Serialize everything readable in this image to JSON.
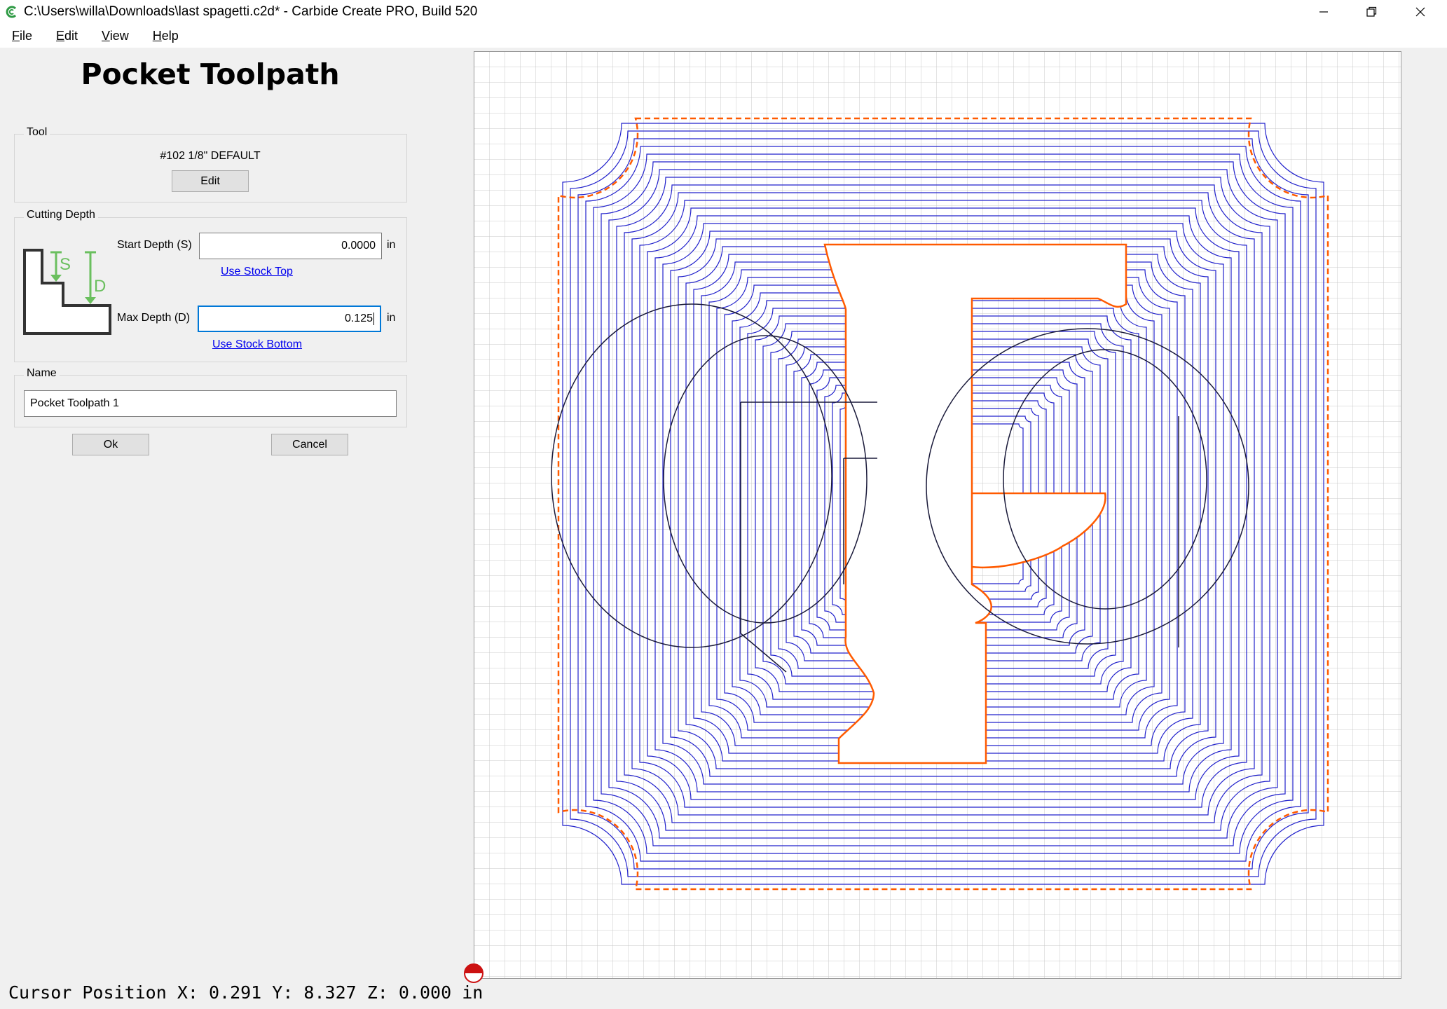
{
  "window": {
    "title": "C:\\Users\\willa\\Downloads\\last spagetti.c2d* - Carbide Create PRO, Build 520",
    "controls": [
      "minimize",
      "restore",
      "close"
    ]
  },
  "menu": {
    "items": [
      {
        "label": "File",
        "accel": "F",
        "rest": "ile"
      },
      {
        "label": "Edit",
        "accel": "E",
        "rest": "dit"
      },
      {
        "label": "View",
        "accel": "V",
        "rest": "iew"
      },
      {
        "label": "Help",
        "accel": "H",
        "rest": "elp"
      }
    ]
  },
  "panel": {
    "heading": "Pocket Toolpath",
    "tool": {
      "group_label": "Tool",
      "tool_name": "#102 1/8\" DEFAULT",
      "edit_label": "Edit"
    },
    "depth": {
      "group_label": "Cutting Depth",
      "diagram_s": "S",
      "diagram_d": "D",
      "start_label": "Start Depth (S)",
      "start_value": "0.0000",
      "start_unit": "in",
      "use_top_label": "Use Stock Top",
      "max_label": "Max Depth (D)",
      "max_value": "0.125",
      "max_unit": "in",
      "use_bottom_label": "Use Stock Bottom"
    },
    "name": {
      "group_label": "Name",
      "value": "Pocket Toolpath 1"
    },
    "ok_label": "Ok",
    "cancel_label": "Cancel"
  },
  "colors": {
    "toolpath": "#2222cc",
    "boundary": "#ff5a00",
    "vector": "#1a1a3a",
    "grid": "#c8c8c8",
    "diagram_green": "#6abf5e"
  },
  "status": {
    "text": "Cursor Position X: 0.291 Y: 8.327 Z: 0.000 in"
  }
}
